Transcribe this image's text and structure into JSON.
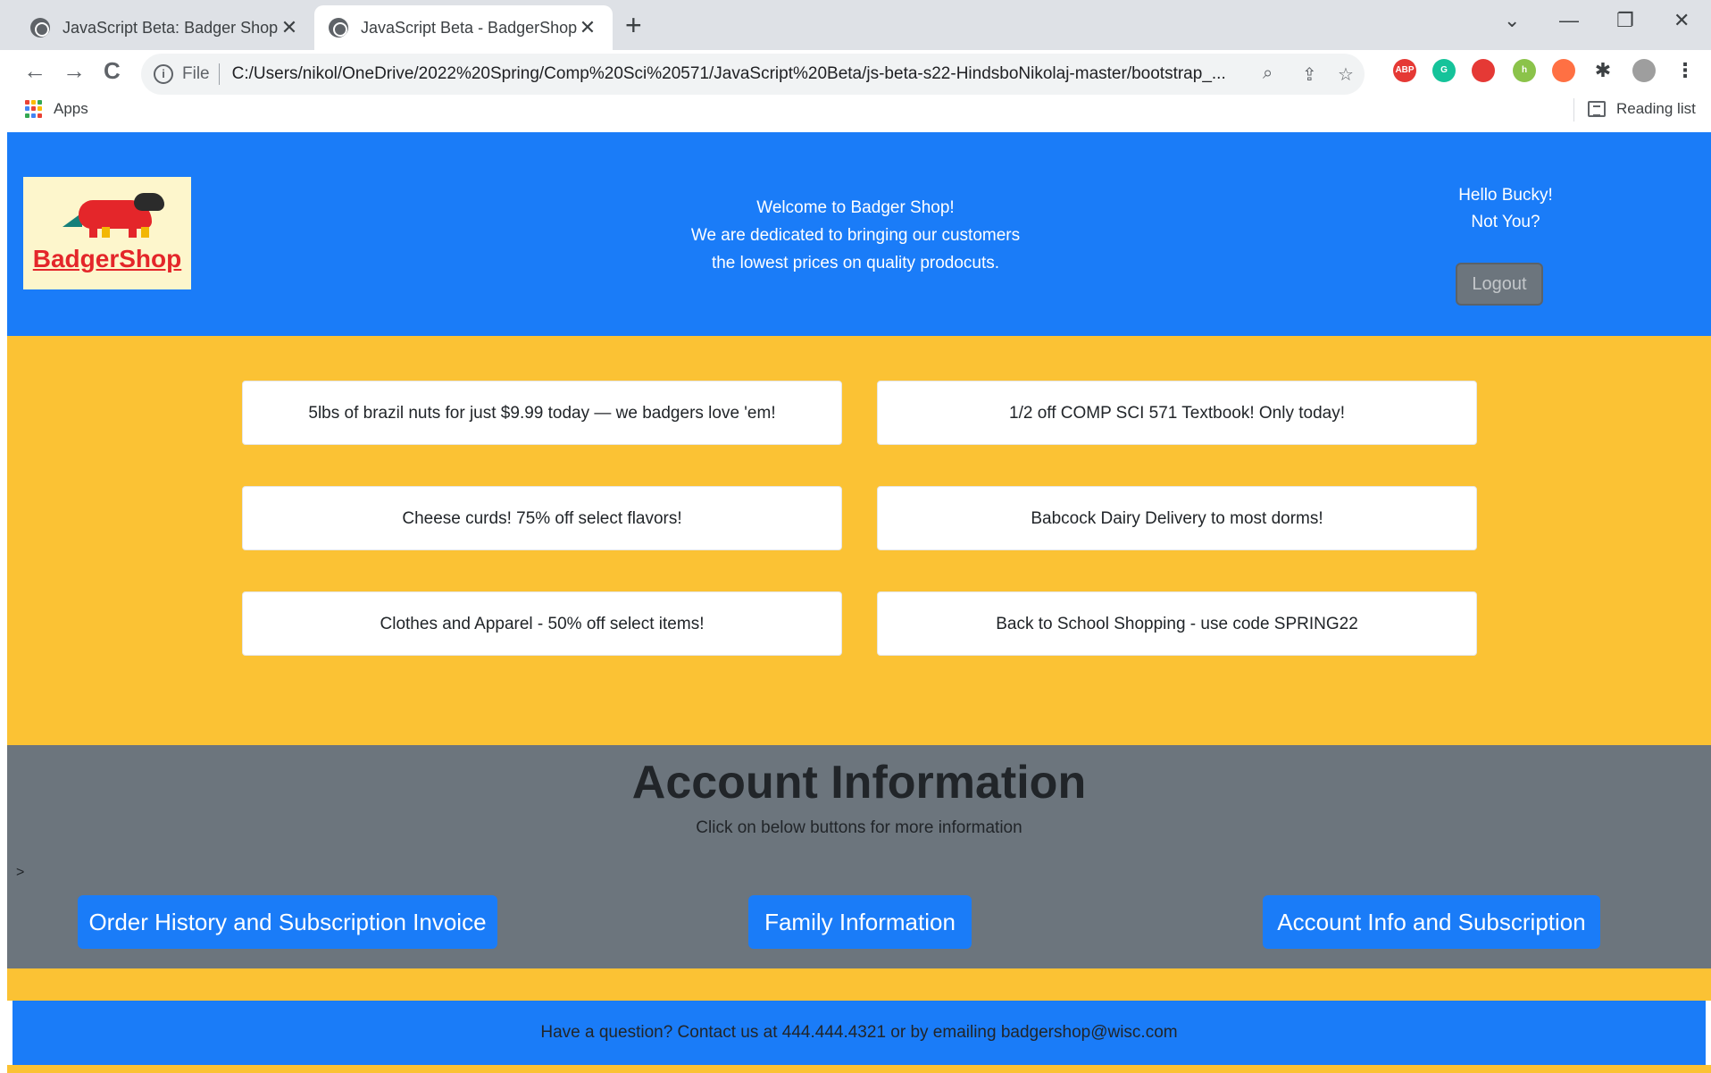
{
  "browser": {
    "tabs": [
      {
        "title": "JavaScript Beta: Badger Shop",
        "active": false
      },
      {
        "title": "JavaScript Beta - BadgerShop",
        "active": true
      }
    ],
    "new_tab": "+",
    "window_controls": {
      "list": "⌄",
      "minimize": "—",
      "restore": "❐",
      "close": "✕"
    },
    "nav": {
      "back": "←",
      "forward": "→",
      "reload": "C"
    },
    "address": {
      "scheme_label": "File",
      "url": "C:/Users/nikol/OneDrive/2022%20Spring/Comp%20Sci%20571/JavaScript%20Beta/js-beta-s22-HindsboNikolaj-master/bootstrap_..."
    },
    "extensions": {
      "abp": "ABP",
      "grammarly": "G",
      "honey": "h"
    },
    "bookmarks": {
      "apps": "Apps",
      "reading_list": "Reading list"
    }
  },
  "header": {
    "logo_text": "BadgerShop",
    "welcome_lines": [
      "Welcome to Badger Shop!",
      "We are dedicated to bringing our customers",
      "the lowest prices on quality prodocuts."
    ],
    "greeting": "Hello Bucky!",
    "not_you": "Not You?",
    "logout_label": "Logout"
  },
  "promos": [
    "5lbs of brazil nuts for just $9.99 today — we badgers love 'em!",
    "1/2 off COMP SCI 571 Textbook! Only today!",
    "Cheese curds! 75% off select flavors!",
    "Babcock Dairy Delivery to most dorms!",
    "Clothes and Apparel - 50% off select items!",
    "Back to School Shopping - use code SPRING22"
  ],
  "account": {
    "title": "Account Information",
    "subtitle": "Click on below buttons for more information",
    "stray_text": ">",
    "buttons": [
      "Order History and Subscription Invoice",
      "Family Information",
      "Account Info and Subscription"
    ]
  },
  "footer": {
    "text": "Have a question? Contact us at 444.444.4321 or by emailing badgershop@wisc.com"
  },
  "colors": {
    "header_blue": "#1a7cf8",
    "promo_yellow": "#fbc234",
    "account_gray": "#6c757d",
    "logout_gray": "#6c757d",
    "logo_red": "#e4262a"
  }
}
